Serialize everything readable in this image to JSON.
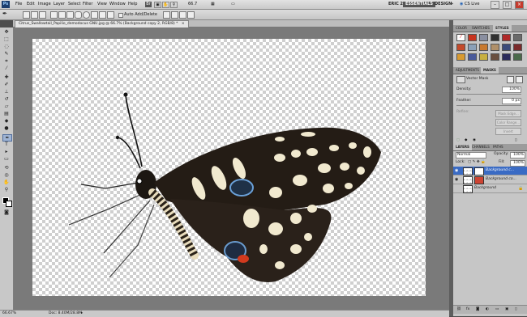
{
  "app": {
    "logo": "Ps"
  },
  "menubar": {
    "items": [
      "File",
      "Edit",
      "Image",
      "Layer",
      "Select",
      "Filter",
      "View",
      "Window",
      "Help"
    ],
    "zoom": "66.7",
    "workspaces": [
      "ERIC 2",
      "ESSENTIALS",
      "DESIGN"
    ],
    "workspaces_more": "»",
    "cs_live": "CS Live",
    "window_controls": [
      "–",
      "□",
      "×"
    ]
  },
  "options": {
    "auto_add_delete": "Auto Add/Delete"
  },
  "document": {
    "tab_title": "Citrus_Swallowtail_Papilio_demodocus GNU.jpg @ 66.7% (Background copy 2, RGB/8) *",
    "tab_close": "×"
  },
  "status": {
    "zoom": "66.67%",
    "doc": "Doc: 8.40M/28.8M"
  },
  "panels": {
    "swatches_tabs": [
      "COLOR",
      "SWATCHES",
      "STYLES"
    ],
    "adjustments_tabs": [
      "ADJUSTMENTS",
      "MASKS"
    ],
    "masks": {
      "vector_mask": "Vector Mask",
      "density_label": "Density:",
      "density_value": "100%",
      "feather_label": "Feather:",
      "feather_value": "0 px",
      "refine_label": "Refine:",
      "mask_edge": "Mask Edge...",
      "color_range": "Color Range...",
      "invert": "Invert"
    },
    "layers_tabs": [
      "LAYERS",
      "CHANNELS",
      "PATHS"
    ],
    "blend_mode": "Normal",
    "opacity_label": "Opacity:",
    "opacity_value": "100%",
    "lock_label": "Lock:",
    "fill_label": "Fill:",
    "fill_value": "100%",
    "layers": [
      "Background c...",
      "Background co...",
      "Background"
    ]
  },
  "colors": {
    "accent": "#3a6bc4",
    "canvas_bg": "#7a7a7a",
    "panel_bg": "#c6c6c6"
  },
  "icons": [
    "pen-tool-icon",
    "move-icon",
    "marquee-icon",
    "lasso-icon",
    "quick-select-icon",
    "crop-icon",
    "eyedropper-icon",
    "brush-icon",
    "eye-icon",
    "link-icon",
    "lock-icon"
  ]
}
